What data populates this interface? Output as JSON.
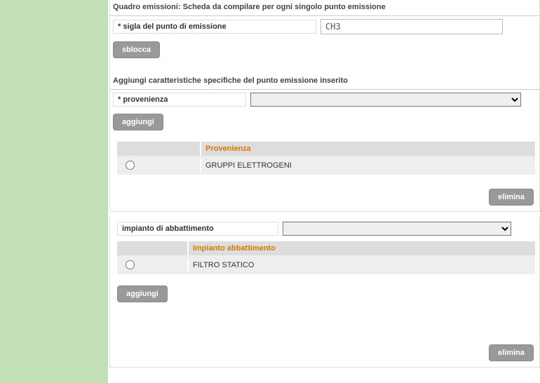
{
  "section1": {
    "title": "Quadro emissioni: Scheda da compilare per ogni singolo punto emissione",
    "sigla_label": "* sigla del punto di emissione",
    "sigla_value": "CH3",
    "sblocca_label": "sblocca"
  },
  "section2": {
    "title": "Aggiungi caratteristiche specifiche del punto emissione inserito",
    "provenienza_label": "* provenienza",
    "provenienza_value": "",
    "aggiungi_label": "aggiungi",
    "table_header": "Provenienza",
    "rows": [
      {
        "label": "GRUPPI ELETTROGENI"
      }
    ],
    "elimina_label": "elimina"
  },
  "section3": {
    "impianto_label": "impianto di abbattimento",
    "impianto_value": "",
    "table_header": "Impianto abbattimento",
    "rows": [
      {
        "label": "FILTRO STATICO"
      }
    ],
    "aggiungi_label": "aggiungi",
    "elimina_label": "elimina"
  }
}
